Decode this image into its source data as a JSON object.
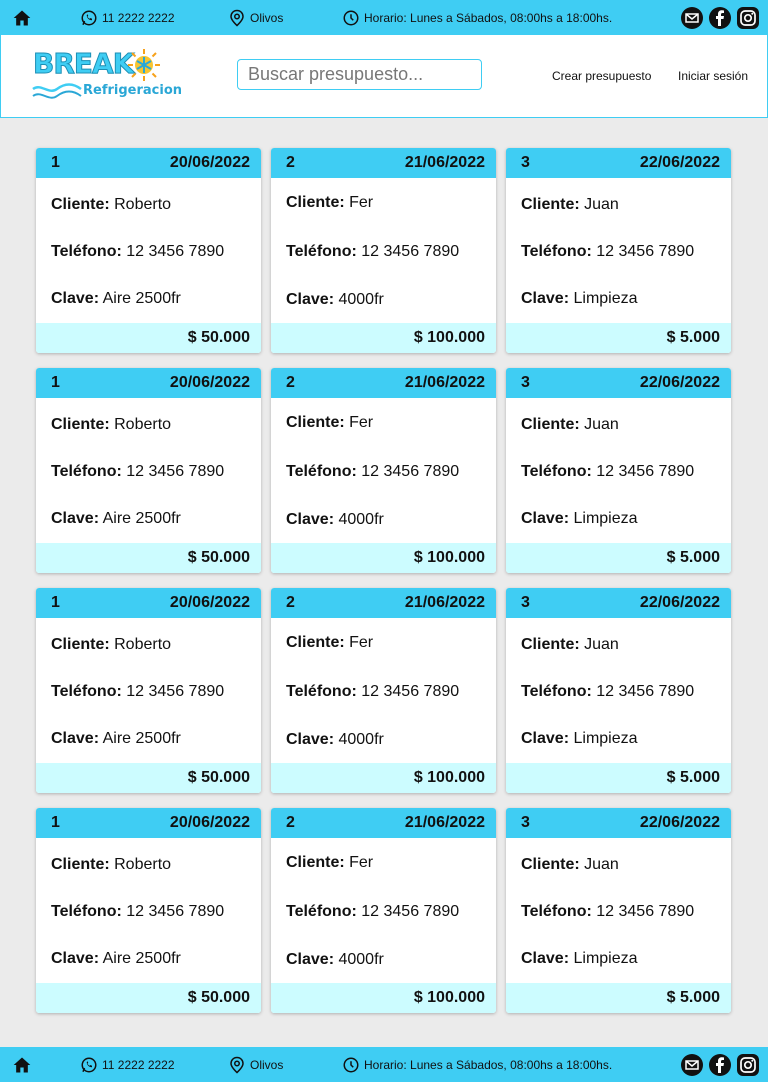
{
  "infobar": {
    "phone": "11 2222 2222",
    "location": "Olivos",
    "hours": "Horario: Lunes a Sábados, 08:00hs a 18:00hs."
  },
  "header": {
    "logo_main": "BREAK",
    "logo_sub": "Refrigeracion",
    "search_placeholder": "Buscar presupuesto...",
    "nav_create": "Crear presupuesto",
    "nav_login": "Iniciar sesión"
  },
  "labels": {
    "client": "Cliente:",
    "phone": "Teléfono:",
    "key": "Clave:"
  },
  "budgets": [
    {
      "id": "1",
      "date": "20/06/2022",
      "client": "Roberto",
      "phone": "12 3456 7890",
      "key": "Aire 2500fr",
      "amount": "$ 50.000"
    },
    {
      "id": "2",
      "date": "21/06/2022",
      "client": "Fer",
      "phone": "12 3456 7890",
      "key": "4000fr",
      "amount": "$ 100.000"
    },
    {
      "id": "3",
      "date": "22/06/2022",
      "client": "Juan",
      "phone": "12 3456 7890",
      "key": "Limpieza",
      "amount": "$ 5.000"
    },
    {
      "id": "1",
      "date": "20/06/2022",
      "client": "Roberto",
      "phone": "12 3456 7890",
      "key": "Aire 2500fr",
      "amount": "$ 50.000"
    },
    {
      "id": "2",
      "date": "21/06/2022",
      "client": "Fer",
      "phone": "12 3456 7890",
      "key": "4000fr",
      "amount": "$ 100.000"
    },
    {
      "id": "3",
      "date": "22/06/2022",
      "client": "Juan",
      "phone": "12 3456 7890",
      "key": "Limpieza",
      "amount": "$ 5.000"
    },
    {
      "id": "1",
      "date": "20/06/2022",
      "client": "Roberto",
      "phone": "12 3456 7890",
      "key": "Aire 2500fr",
      "amount": "$ 50.000"
    },
    {
      "id": "2",
      "date": "21/06/2022",
      "client": "Fer",
      "phone": "12 3456 7890",
      "key": "4000fr",
      "amount": "$ 100.000"
    },
    {
      "id": "3",
      "date": "22/06/2022",
      "client": "Juan",
      "phone": "12 3456 7890",
      "key": "Limpieza",
      "amount": "$ 5.000"
    },
    {
      "id": "1",
      "date": "20/06/2022",
      "client": "Roberto",
      "phone": "12 3456 7890",
      "key": "Aire 2500fr",
      "amount": "$ 50.000"
    },
    {
      "id": "2",
      "date": "21/06/2022",
      "client": "Fer",
      "phone": "12 3456 7890",
      "key": "4000fr",
      "amount": "$ 100.000"
    },
    {
      "id": "3",
      "date": "22/06/2022",
      "client": "Juan",
      "phone": "12 3456 7890",
      "key": "Limpieza",
      "amount": "$ 5.000"
    }
  ],
  "colors": {
    "accent": "#3fcdf3",
    "footer_band": "#ccfcff",
    "background": "#ebebeb"
  },
  "icons": [
    "home-icon",
    "whatsapp-icon",
    "location-pin-icon",
    "clock-icon",
    "email-icon",
    "facebook-icon",
    "instagram-icon",
    "search-icon",
    "snowflake-icon"
  ]
}
